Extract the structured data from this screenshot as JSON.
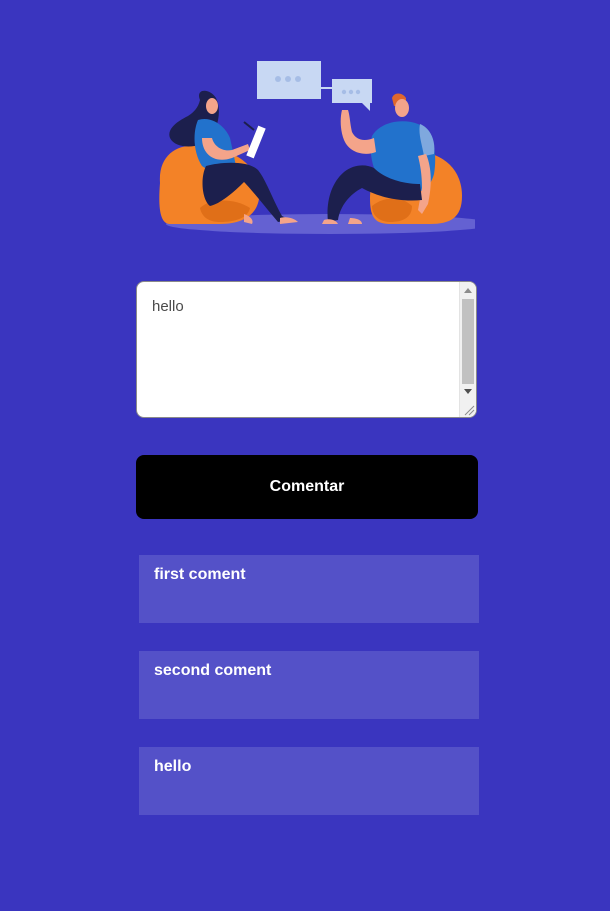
{
  "comment_form": {
    "textarea_value": "hello",
    "button_label": "Comentar"
  },
  "comments": [
    {
      "text": "first coment"
    },
    {
      "text": "second coment"
    },
    {
      "text": "hello"
    }
  ],
  "colors": {
    "background": "#3a35bf",
    "card": "#5451c8",
    "button": "#000000"
  }
}
